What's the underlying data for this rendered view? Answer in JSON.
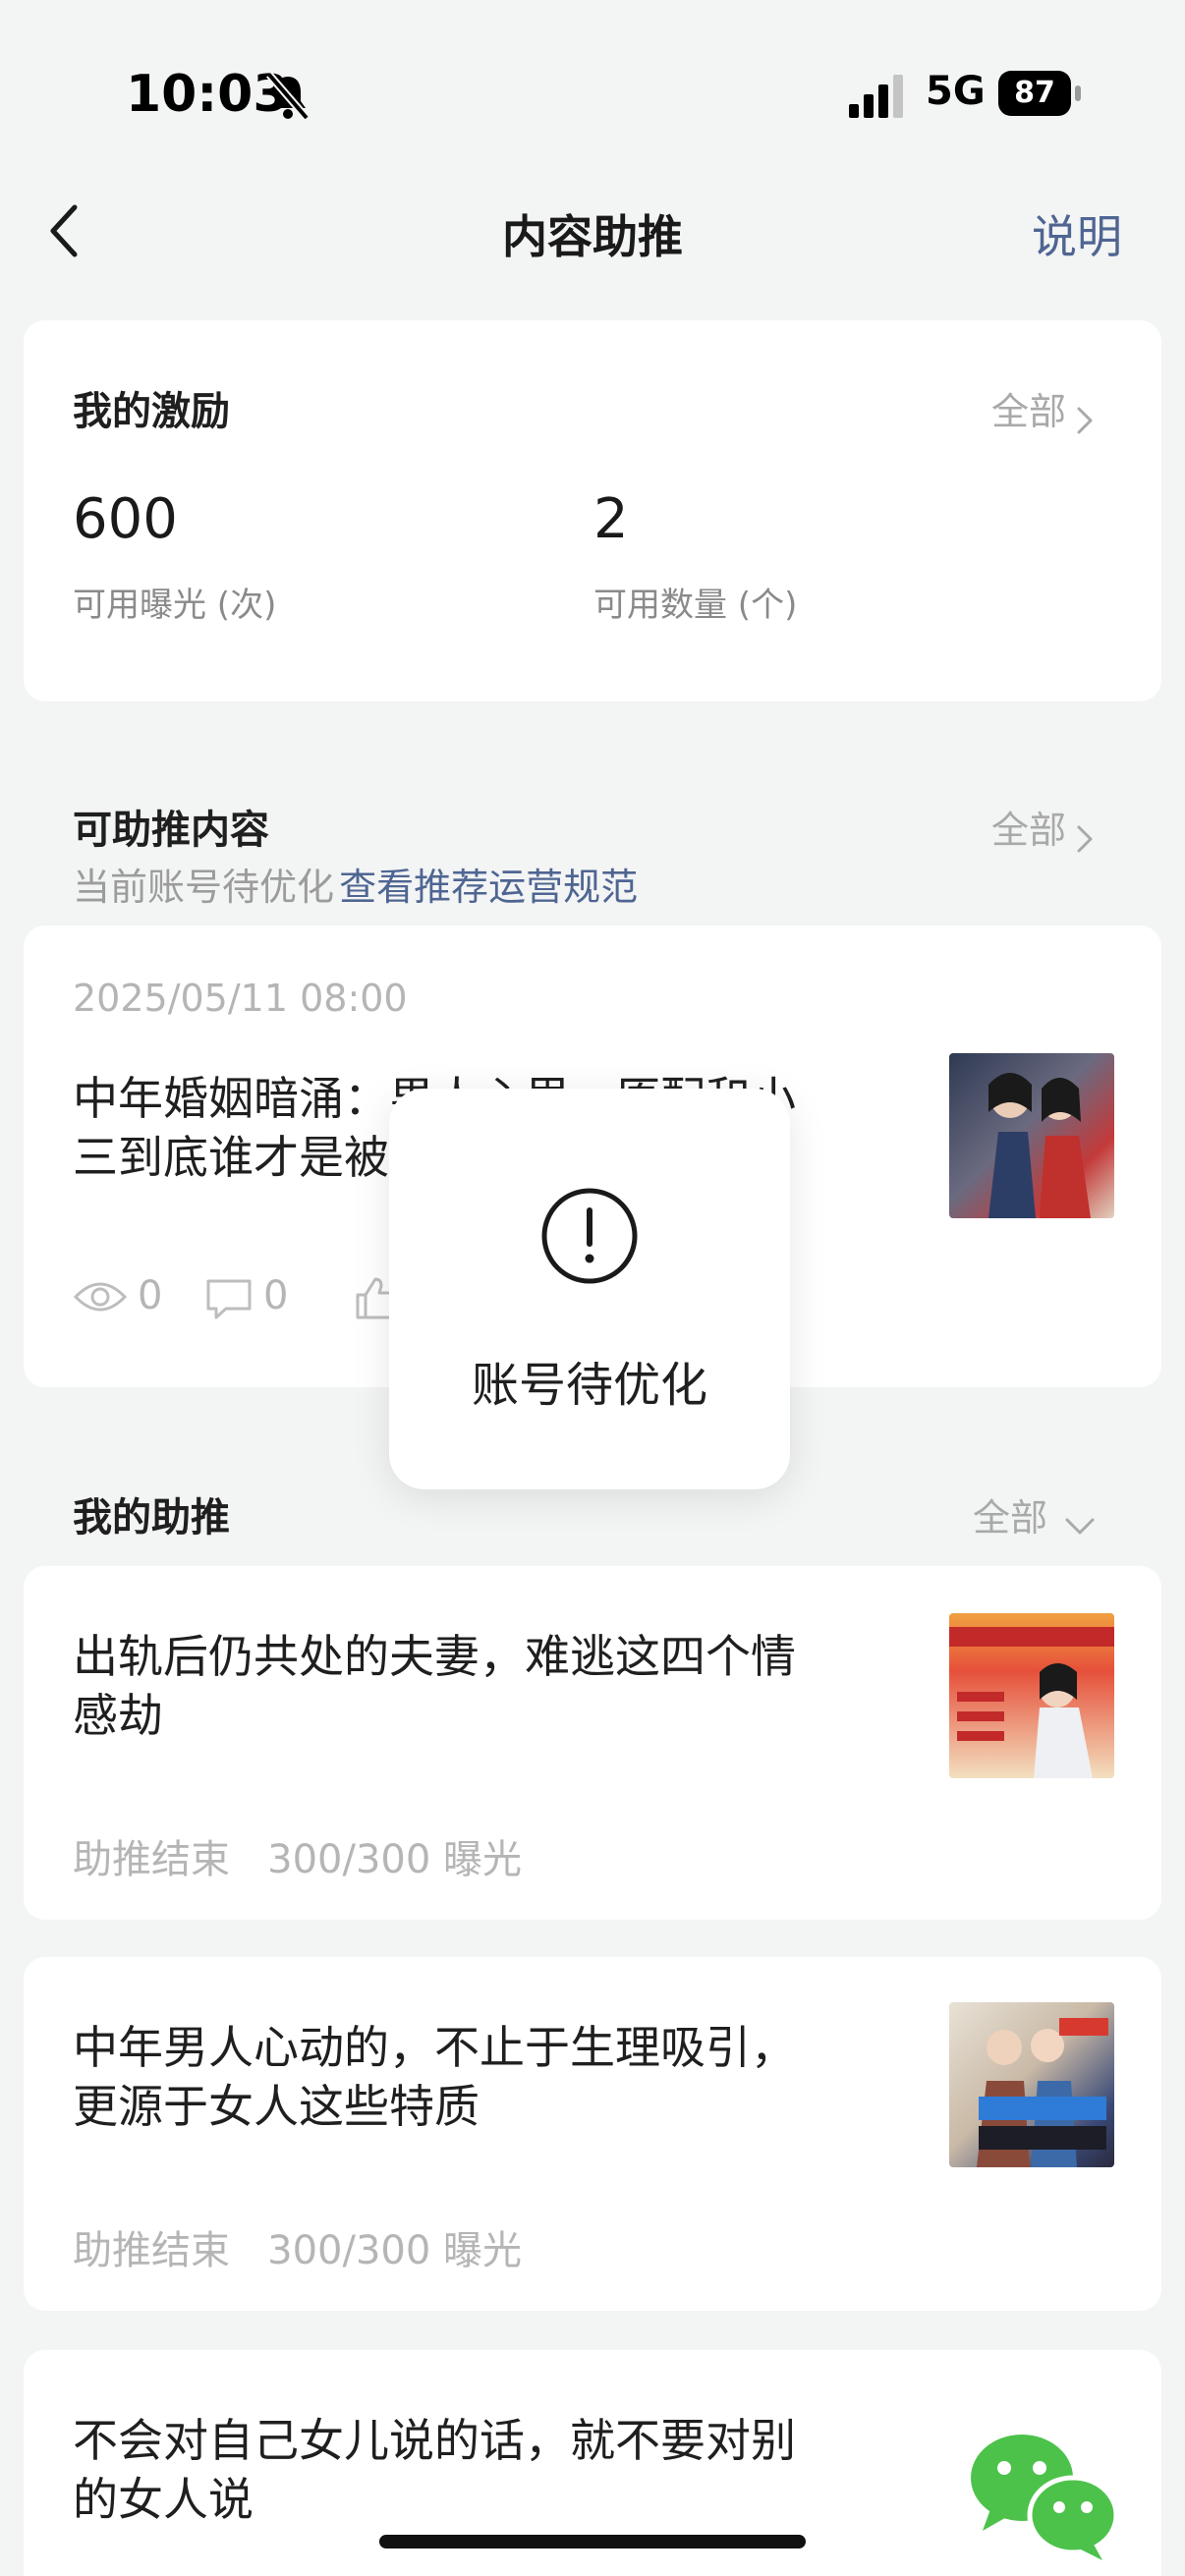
{
  "status_bar": {
    "time": "10:03",
    "network": "5G",
    "battery": "87"
  },
  "nav": {
    "title": "内容助推",
    "help": "说明"
  },
  "incentive": {
    "title": "我的激励",
    "all": "全部",
    "exposure_value": "600",
    "exposure_label": "可用曝光 (次)",
    "count_value": "2",
    "count_label": "可用数量 (个)"
  },
  "boostable": {
    "title": "可助推内容",
    "all": "全部",
    "hint": "当前账号待优化",
    "hint_link": "查看推荐运营规范",
    "item": {
      "date": "2025/05/11 08:00",
      "title_line1": "中年婚姻暗涌：男人心里，原配和小",
      "title_line2": "三到底谁才是被",
      "views": "0",
      "comments": "0"
    }
  },
  "toast": {
    "text": "账号待优化"
  },
  "my_boosts": {
    "title": "我的助推",
    "all": "全部",
    "items": [
      {
        "title_line1": "出轨后仍共处的夫妻，难逃这四个情",
        "title_line2": "感劫",
        "status": "助推结束",
        "exposure": "300/300 曝光"
      },
      {
        "title_line1": "中年男人心动的，不止于生理吸引，",
        "title_line2": "更源于女人这些特质",
        "status": "助推结束",
        "exposure": "300/300 曝光"
      },
      {
        "title_line1": "不会对自己女儿说的话，就不要对别",
        "title_line2": "的女人说"
      }
    ]
  },
  "icons": [
    "chevron-left-icon",
    "bell-slash-icon",
    "signal-icon",
    "chevron-right-icon",
    "eye-icon",
    "comment-icon",
    "thumbs-up-icon",
    "exclamation-icon",
    "chevron-down-icon",
    "wechat-icon"
  ]
}
